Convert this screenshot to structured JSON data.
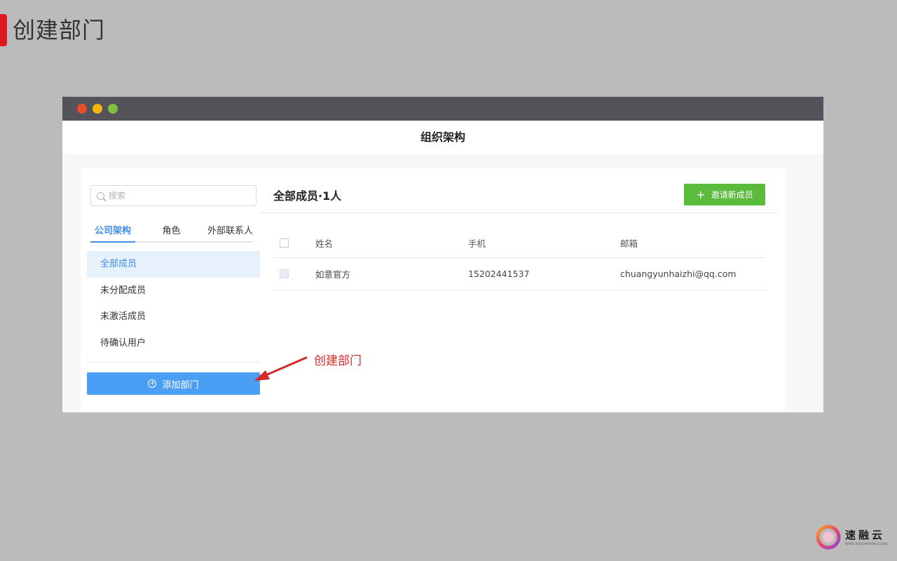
{
  "slide": {
    "title": "创建部门"
  },
  "app": {
    "header": "组织架构"
  },
  "sidebar": {
    "search_placeholder": "搜索",
    "tabs": [
      {
        "label": "公司架构",
        "active": true
      },
      {
        "label": "角色",
        "active": false
      },
      {
        "label": "外部联系人",
        "active": false
      }
    ],
    "items": [
      {
        "label": "全部成员",
        "active": true
      },
      {
        "label": "未分配成员",
        "active": false
      },
      {
        "label": "未激活成员",
        "active": false
      },
      {
        "label": "待确认用户",
        "active": false
      }
    ],
    "add_department_label": "添加部门"
  },
  "main": {
    "title": "全部成员·1人",
    "invite_label": "邀请新成员",
    "columns": [
      "姓名",
      "手机",
      "邮箱"
    ],
    "rows": [
      {
        "name": "如意官方",
        "phone": "15202441537",
        "email": "chuangyunhaizhi@qq.com"
      }
    ]
  },
  "annotation": {
    "text": "创建部门"
  },
  "logo": {
    "name_cn": "速融云",
    "name_en": "RAPID INTEGRATION CLOUD"
  },
  "colors": {
    "accent_red": "#e0191f",
    "primary_blue": "#4a9ff5",
    "invite_green": "#5bbb3d",
    "annotation_red": "#d42a26"
  }
}
